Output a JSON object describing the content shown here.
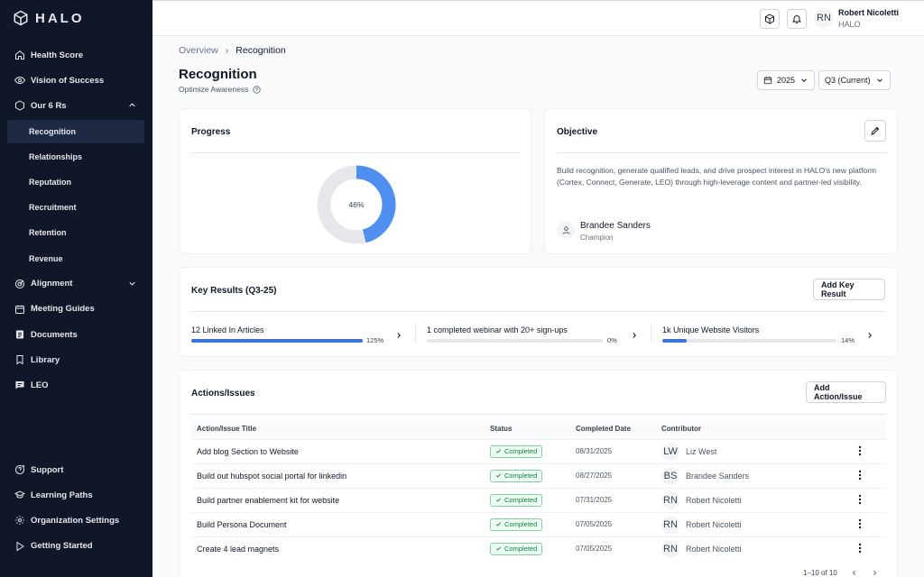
{
  "app": {
    "logo_text": "HALO"
  },
  "sidebar": {
    "items": [
      {
        "label": "Health Score",
        "icon": "home-icon"
      },
      {
        "label": "Vision of Success",
        "icon": "eye-icon"
      },
      {
        "label": "Our 6 Rs",
        "icon": "hexagon-icon"
      },
      {
        "label": "Recognition"
      },
      {
        "label": "Relationships"
      },
      {
        "label": "Reputation"
      },
      {
        "label": "Recruitment"
      },
      {
        "label": "Retention"
      },
      {
        "label": "Revenue"
      },
      {
        "label": "Alignment",
        "icon": "target-icon"
      },
      {
        "label": "Meeting Guides",
        "icon": "calendar-icon"
      },
      {
        "label": "Documents",
        "icon": "document-icon"
      },
      {
        "label": "Library",
        "icon": "bookmark-icon"
      },
      {
        "label": "LEO",
        "icon": "chat-icon"
      }
    ],
    "bottom_items": [
      {
        "label": "Support",
        "icon": "support-chat-icon"
      },
      {
        "label": "Learning Paths",
        "icon": "graduation-cap-icon"
      },
      {
        "label": "Organization Settings",
        "icon": "gear-icon"
      },
      {
        "label": "Getting Started",
        "icon": "play-icon"
      }
    ]
  },
  "topbar": {
    "avatar_initials": "RN",
    "user_name": "Robert Nicoletti",
    "user_org": "HALO"
  },
  "breadcrumb": {
    "parent": "Overview",
    "separator": "›",
    "current": "Recognition"
  },
  "page": {
    "title": "Recognition",
    "subtitle": "Optimize Awareness",
    "year": "2025",
    "quarter": "Q3 (Current)"
  },
  "progress": {
    "title": "Progress",
    "percent_label": "46%",
    "value": 0.46,
    "colors": {
      "fill": "#4f8ff0",
      "track": "#e5e7eb"
    }
  },
  "objective": {
    "title": "Objective",
    "text": "Build recognition, generate qualified leads, and drive prospect interest in HALO's new platform (Cortex, Connect, Generate, LEO) through high-leverage content and partner-led visibility.",
    "champion_name": "Brandee Sanders",
    "champion_role": "Champion"
  },
  "key_results": {
    "title": "Key Results (Q3-25)",
    "add_label": "Add Key Result",
    "items": [
      {
        "label": "12 Linked In Articles",
        "pct_label": "125%",
        "fill": 1.0
      },
      {
        "label": "1 completed webinar with 20+ sign-ups",
        "pct_label": "0%",
        "fill": 0.0
      },
      {
        "label": "1k Unique Website Visitors",
        "pct_label": "14%",
        "fill": 0.14
      }
    ]
  },
  "actions": {
    "title": "Actions/Issues",
    "add_label": "Add Action/Issue",
    "columns": [
      "Action/Issue Title",
      "Status",
      "Completed Date",
      "Contributor"
    ],
    "rows": [
      {
        "title": "Add blog Section to Website",
        "status": "Completed",
        "date": "08/31/2025",
        "initials": "LW",
        "contributor": "Liz West"
      },
      {
        "title": "Build out hubspot social portal for linkedin",
        "status": "Completed",
        "date": "08/27/2025",
        "initials": "BS",
        "contributor": "Brandee Sanders"
      },
      {
        "title": "Build partner enablement kit for website",
        "status": "Completed",
        "date": "07/31/2025",
        "initials": "RN",
        "contributor": "Robert Nicoletti"
      },
      {
        "title": "Build Persona Document",
        "status": "Completed",
        "date": "07/05/2025",
        "initials": "RN",
        "contributor": "Robert Nicoletti"
      },
      {
        "title": "Create 4 lead magnets",
        "status": "Completed",
        "date": "07/05/2025",
        "initials": "RN",
        "contributor": "Robert Nicoletti"
      }
    ],
    "pagination": "1–10 of 10"
  },
  "colors": {
    "sidebar_bg": "#0f1729",
    "accent": "#3b74d9",
    "success": "#15803d"
  }
}
